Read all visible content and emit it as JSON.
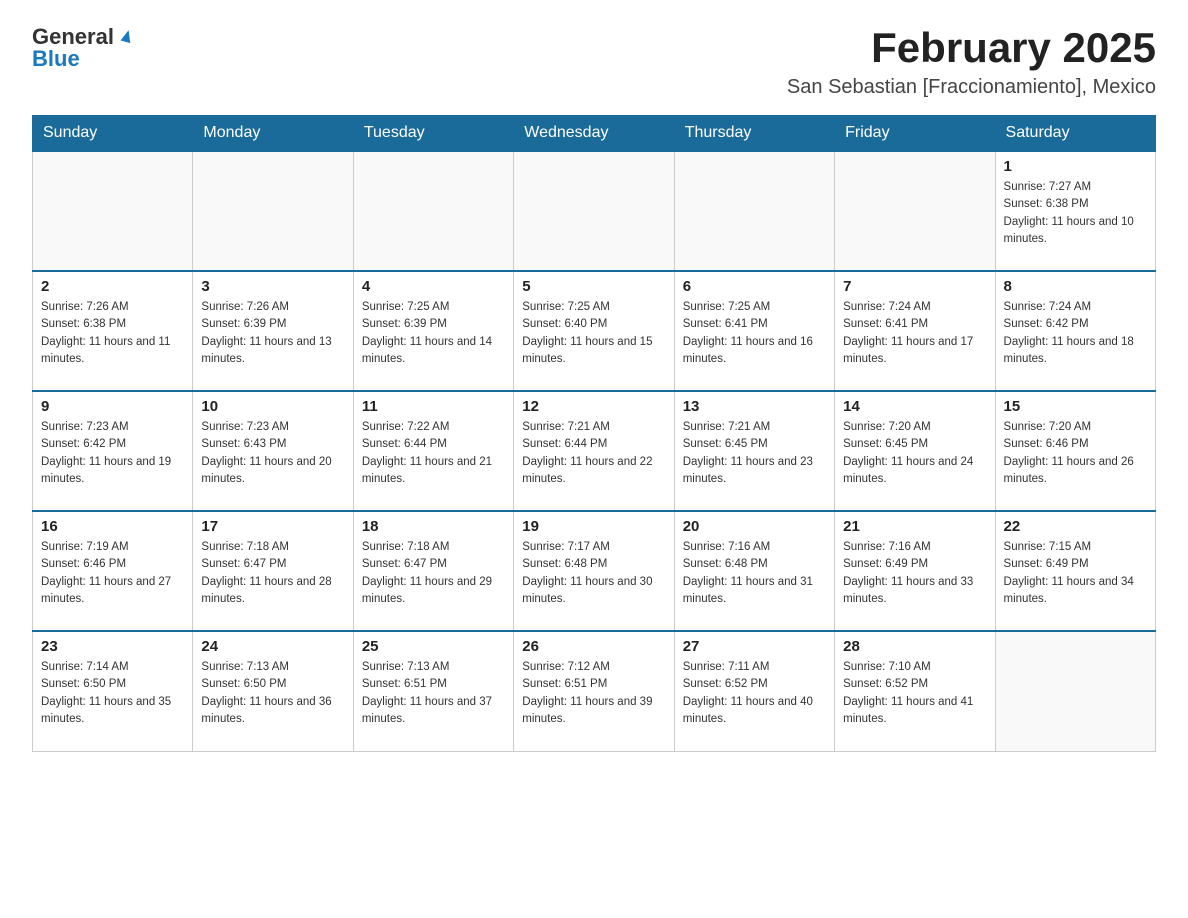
{
  "header": {
    "logo_general": "General",
    "logo_blue": "Blue",
    "title": "February 2025",
    "subtitle": "San Sebastian [Fraccionamiento], Mexico"
  },
  "calendar": {
    "days_of_week": [
      "Sunday",
      "Monday",
      "Tuesday",
      "Wednesday",
      "Thursday",
      "Friday",
      "Saturday"
    ],
    "weeks": [
      [
        {
          "day": "",
          "info": ""
        },
        {
          "day": "",
          "info": ""
        },
        {
          "day": "",
          "info": ""
        },
        {
          "day": "",
          "info": ""
        },
        {
          "day": "",
          "info": ""
        },
        {
          "day": "",
          "info": ""
        },
        {
          "day": "1",
          "info": "Sunrise: 7:27 AM\nSunset: 6:38 PM\nDaylight: 11 hours and 10 minutes."
        }
      ],
      [
        {
          "day": "2",
          "info": "Sunrise: 7:26 AM\nSunset: 6:38 PM\nDaylight: 11 hours and 11 minutes."
        },
        {
          "day": "3",
          "info": "Sunrise: 7:26 AM\nSunset: 6:39 PM\nDaylight: 11 hours and 13 minutes."
        },
        {
          "day": "4",
          "info": "Sunrise: 7:25 AM\nSunset: 6:39 PM\nDaylight: 11 hours and 14 minutes."
        },
        {
          "day": "5",
          "info": "Sunrise: 7:25 AM\nSunset: 6:40 PM\nDaylight: 11 hours and 15 minutes."
        },
        {
          "day": "6",
          "info": "Sunrise: 7:25 AM\nSunset: 6:41 PM\nDaylight: 11 hours and 16 minutes."
        },
        {
          "day": "7",
          "info": "Sunrise: 7:24 AM\nSunset: 6:41 PM\nDaylight: 11 hours and 17 minutes."
        },
        {
          "day": "8",
          "info": "Sunrise: 7:24 AM\nSunset: 6:42 PM\nDaylight: 11 hours and 18 minutes."
        }
      ],
      [
        {
          "day": "9",
          "info": "Sunrise: 7:23 AM\nSunset: 6:42 PM\nDaylight: 11 hours and 19 minutes."
        },
        {
          "day": "10",
          "info": "Sunrise: 7:23 AM\nSunset: 6:43 PM\nDaylight: 11 hours and 20 minutes."
        },
        {
          "day": "11",
          "info": "Sunrise: 7:22 AM\nSunset: 6:44 PM\nDaylight: 11 hours and 21 minutes."
        },
        {
          "day": "12",
          "info": "Sunrise: 7:21 AM\nSunset: 6:44 PM\nDaylight: 11 hours and 22 minutes."
        },
        {
          "day": "13",
          "info": "Sunrise: 7:21 AM\nSunset: 6:45 PM\nDaylight: 11 hours and 23 minutes."
        },
        {
          "day": "14",
          "info": "Sunrise: 7:20 AM\nSunset: 6:45 PM\nDaylight: 11 hours and 24 minutes."
        },
        {
          "day": "15",
          "info": "Sunrise: 7:20 AM\nSunset: 6:46 PM\nDaylight: 11 hours and 26 minutes."
        }
      ],
      [
        {
          "day": "16",
          "info": "Sunrise: 7:19 AM\nSunset: 6:46 PM\nDaylight: 11 hours and 27 minutes."
        },
        {
          "day": "17",
          "info": "Sunrise: 7:18 AM\nSunset: 6:47 PM\nDaylight: 11 hours and 28 minutes."
        },
        {
          "day": "18",
          "info": "Sunrise: 7:18 AM\nSunset: 6:47 PM\nDaylight: 11 hours and 29 minutes."
        },
        {
          "day": "19",
          "info": "Sunrise: 7:17 AM\nSunset: 6:48 PM\nDaylight: 11 hours and 30 minutes."
        },
        {
          "day": "20",
          "info": "Sunrise: 7:16 AM\nSunset: 6:48 PM\nDaylight: 11 hours and 31 minutes."
        },
        {
          "day": "21",
          "info": "Sunrise: 7:16 AM\nSunset: 6:49 PM\nDaylight: 11 hours and 33 minutes."
        },
        {
          "day": "22",
          "info": "Sunrise: 7:15 AM\nSunset: 6:49 PM\nDaylight: 11 hours and 34 minutes."
        }
      ],
      [
        {
          "day": "23",
          "info": "Sunrise: 7:14 AM\nSunset: 6:50 PM\nDaylight: 11 hours and 35 minutes."
        },
        {
          "day": "24",
          "info": "Sunrise: 7:13 AM\nSunset: 6:50 PM\nDaylight: 11 hours and 36 minutes."
        },
        {
          "day": "25",
          "info": "Sunrise: 7:13 AM\nSunset: 6:51 PM\nDaylight: 11 hours and 37 minutes."
        },
        {
          "day": "26",
          "info": "Sunrise: 7:12 AM\nSunset: 6:51 PM\nDaylight: 11 hours and 39 minutes."
        },
        {
          "day": "27",
          "info": "Sunrise: 7:11 AM\nSunset: 6:52 PM\nDaylight: 11 hours and 40 minutes."
        },
        {
          "day": "28",
          "info": "Sunrise: 7:10 AM\nSunset: 6:52 PM\nDaylight: 11 hours and 41 minutes."
        },
        {
          "day": "",
          "info": ""
        }
      ]
    ]
  }
}
